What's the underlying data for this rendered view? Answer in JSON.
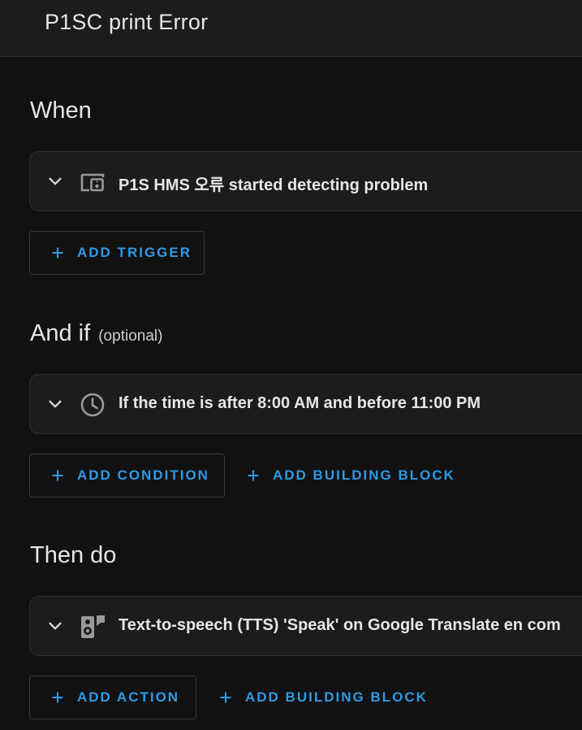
{
  "header": {
    "title": "P1SC print Error"
  },
  "triggers": {
    "heading": "When",
    "items": [
      {
        "icon": "devices-icon",
        "label": "P1S HMS 오류 started detecting problem"
      }
    ],
    "add_label": "ADD TRIGGER"
  },
  "conditions": {
    "heading": "And if",
    "optional": "(optional)",
    "items": [
      {
        "icon": "clock-icon",
        "label": "If the time is after 8:00 AM and before 11:00 PM"
      }
    ],
    "add_label": "ADD CONDITION",
    "add_block_label": "ADD BUILDING BLOCK"
  },
  "actions": {
    "heading": "Then do",
    "items": [
      {
        "icon": "speaker-message-icon",
        "label": "Text-to-speech (TTS) 'Speak' on Google Translate en com"
      }
    ],
    "add_label": "ADD ACTION",
    "add_block_label": "ADD BUILDING BLOCK"
  },
  "colors": {
    "background": "#111111",
    "card": "#1c1c1c",
    "accent": "#2f9ae6",
    "text": "#e1e1e1"
  }
}
